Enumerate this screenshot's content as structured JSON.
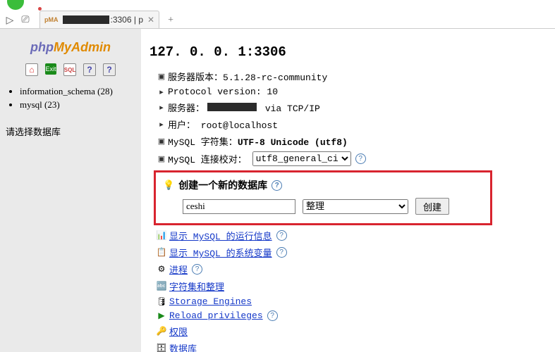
{
  "tab": {
    "title_suffix": ":3306 | p"
  },
  "sidebar": {
    "logo": {
      "part1": "php",
      "part2": "MyAdmin"
    },
    "icons": {
      "home": "⌂",
      "exit": "Exit",
      "sql": "SQL",
      "help1": "?",
      "help2": "?"
    },
    "databases": [
      {
        "name": "information_schema",
        "count": "(28)"
      },
      {
        "name": "mysql",
        "count": "(23)"
      }
    ],
    "prompt": "请选择数据库"
  },
  "main": {
    "heading": "127. 0. 0. 1:3306",
    "info": {
      "version_label": "服务器版本：",
      "version_value": "5.1.28-rc-community",
      "protocol": "Protocol version: 10",
      "server_label": "服务器：",
      "server_suffix": " via TCP/IP",
      "user": "用户： root@localhost",
      "charset_label": "MySQL 字符集：",
      "charset_value": "UTF-8 Unicode (utf8)",
      "collation_label": "MySQL 连接校对："
    },
    "collation_select": "utf8_general_ci",
    "create_box": {
      "title": "创建一个新的数据库",
      "name_value": "ceshi",
      "collation_placeholder": "整理",
      "button": "创建"
    },
    "links": [
      {
        "icon": "📊",
        "text": "显示 MySQL 的运行信息",
        "help": true
      },
      {
        "icon": "📋",
        "text": "显示 MySQL 的系统变量",
        "help": true
      },
      {
        "icon": "⚙",
        "text": "进程",
        "help": true
      },
      {
        "icon": "🔤",
        "text": "字符集和整理",
        "help": false
      },
      {
        "icon": "🛢",
        "text": "Storage Engines",
        "help": false
      },
      {
        "icon": "▶",
        "text": "Reload privileges",
        "help": true,
        "green": true
      },
      {
        "icon": "🔑",
        "text": "权限",
        "help": false
      },
      {
        "icon": "🗄",
        "text": "数据库",
        "help": false
      }
    ]
  }
}
